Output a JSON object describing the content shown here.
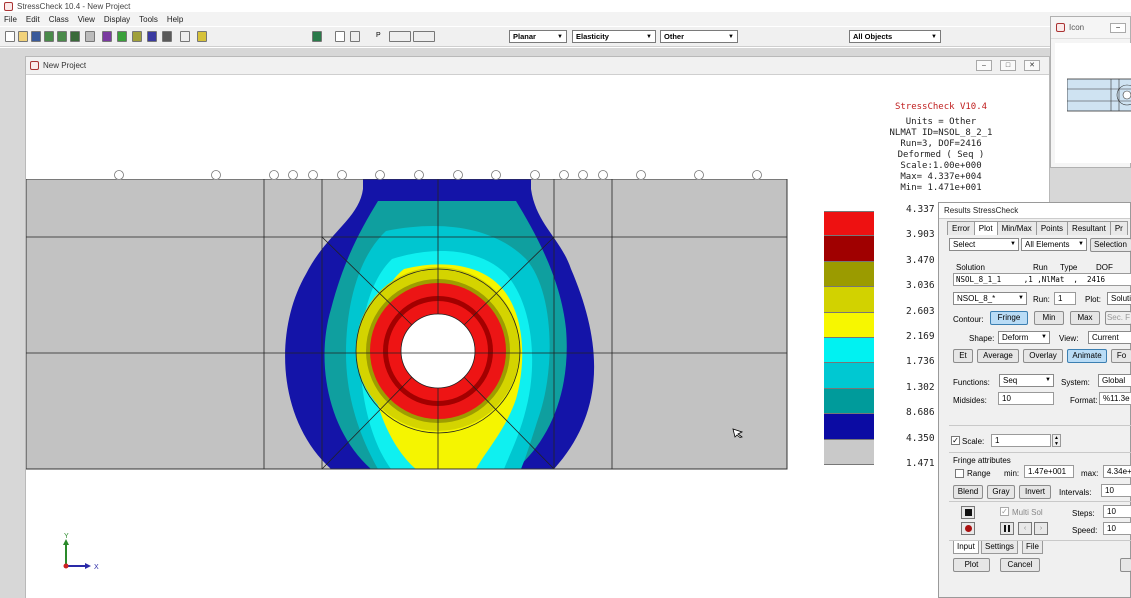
{
  "app": {
    "title": "StressCheck 10.4 - New Project",
    "menu": [
      "File",
      "Edit",
      "Class",
      "View",
      "Display",
      "Tools",
      "Help"
    ]
  },
  "toolbar": {
    "p_label": "P",
    "combos": {
      "analysis": "Planar",
      "material": "Elasticity",
      "other": "Other",
      "objects": "All Objects"
    }
  },
  "project_window": {
    "title": "New Project",
    "controls": [
      "–",
      "□",
      "✕"
    ]
  },
  "icon_window": {
    "title": "Icon",
    "controls": [
      "–"
    ]
  },
  "plot_info": {
    "title": "StressCheck V10.4",
    "lines": [
      "Units = Other",
      "NLMAT ID=NSOL_8_2_1",
      "Run=3, DOF=2416",
      "Deformed ( Seq )",
      "Scale:1.00e+000",
      "Max= 4.337e+004",
      "Min= 1.471e+001"
    ]
  },
  "legend": {
    "colors": [
      "#ee1111",
      "#a00000",
      "#9b9b00",
      "#d2d200",
      "#f7f700",
      "#00f2f2",
      "#00c8d2",
      "#009b9b",
      "#0b0ba3",
      "#c9c9c9"
    ],
    "labels": [
      "4.337",
      "3.903",
      "3.470",
      "3.036",
      "2.603",
      "2.169",
      "1.736",
      "1.302",
      "8.686",
      "4.350",
      "1.471"
    ]
  },
  "axes": {
    "y_label": "Y",
    "x_label": "X"
  },
  "results_dialog": {
    "title": "Results StressCheck",
    "tabs": [
      "Error",
      "Plot",
      "Min/Max",
      "Points",
      "Resultant",
      "Pr"
    ],
    "active_tab": "Plot",
    "select_combo": "Select",
    "elements_combo": "All Elements",
    "selection_label": "Selection",
    "solution_headers": [
      "Solution",
      "Run",
      "Type",
      "DOF"
    ],
    "solution_row": "NSOL_8_1_1     ,1 ,NlMat  ,  2416",
    "solution_combo": "NSOL_8_*",
    "run_label": "Run:",
    "run_value": "1",
    "plot_label": "Plot:",
    "plot_value": "Soluti",
    "contour_label": "Contour:",
    "fringe_btn": "Fringe",
    "min_btn": "Min",
    "max_btn": "Max",
    "sec_btn": "Sec. F",
    "shape_label": "Shape:",
    "shape_value": "Deform",
    "view_label": "View:",
    "view_value": "Current",
    "et_btn": "Et",
    "average_btn": "Average",
    "overlay_btn": "Overlay",
    "animate_btn": "Animate",
    "fo_btn": "Fo",
    "functions_label": "Functions:",
    "functions_value": "Seq",
    "system_label": "System:",
    "system_value": "Global",
    "midsides_label": "Midsides:",
    "midsides_value": "10",
    "format_label": "Format:",
    "format_value": "%11.3e",
    "scale_label": "Scale:",
    "scale_value": "1",
    "fringe_attr_label": "Fringe attributes",
    "range_label": "Range",
    "min_label": "min:",
    "min_value": "1.47e+001",
    "max_label": "max:",
    "max_value": "4.34e+",
    "blend_btn": "Blend",
    "gray_btn": "Gray",
    "invert_btn": "Invert",
    "intervals_label": "Intervals:",
    "intervals_value": "10",
    "multi_sol_label": "Multi Sol",
    "steps_label": "Steps:",
    "steps_value": "10",
    "speed_label": "Speed:",
    "speed_value": "10",
    "bottom_tabs": [
      "Input",
      "Settings",
      "File"
    ],
    "plot_btn": "Plot",
    "cancel_btn": "Cancel"
  }
}
